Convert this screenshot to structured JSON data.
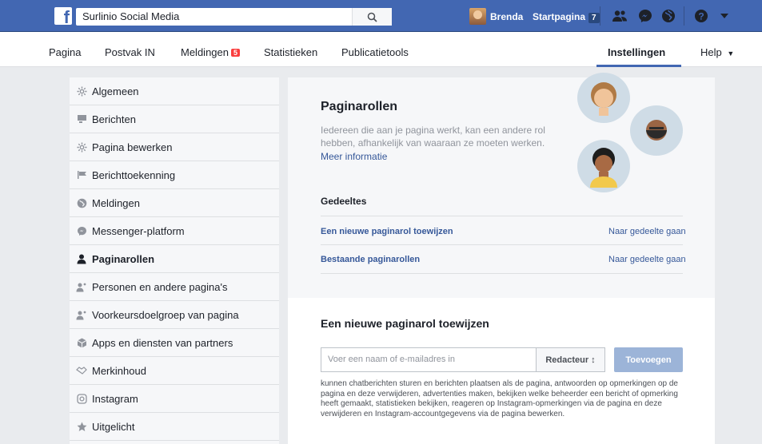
{
  "topbar": {
    "search_value": "Surlinio Social Media",
    "user_name": "Brenda",
    "home_label": "Startpagina",
    "home_count": "7"
  },
  "pagenav": {
    "items": {
      "pagina": "Pagina",
      "postvak": "Postvak IN",
      "meldingen": "Meldingen",
      "meldingen_badge": "5",
      "statistieken": "Statistieken",
      "publicatietools": "Publicatietools",
      "instellingen": "Instellingen",
      "help": "Help"
    }
  },
  "sidebar": {
    "items": [
      {
        "label": "Algemeen",
        "icon": "gear-icon"
      },
      {
        "label": "Berichten",
        "icon": "messages-icon"
      },
      {
        "label": "Pagina bewerken",
        "icon": "gear-icon"
      },
      {
        "label": "Berichttoekenning",
        "icon": "flag-icon"
      },
      {
        "label": "Meldingen",
        "icon": "globe-icon"
      },
      {
        "label": "Messenger-platform",
        "icon": "messenger-icon"
      },
      {
        "label": "Paginarollen",
        "icon": "person-icon",
        "active": true
      },
      {
        "label": "Personen en andere pagina's",
        "icon": "people-icon"
      },
      {
        "label": "Voorkeursdoelgroep van pagina",
        "icon": "people-icon"
      },
      {
        "label": "Apps en diensten van partners",
        "icon": "cube-icon"
      },
      {
        "label": "Merkinhoud",
        "icon": "handshake-icon"
      },
      {
        "label": "Instagram",
        "icon": "instagram-icon"
      },
      {
        "label": "Uitgelicht",
        "icon": "star-icon"
      }
    ]
  },
  "roles": {
    "title": "Paginarollen",
    "intro": "Iedereen die aan je pagina werkt, kan een andere rol hebben, afhankelijk van waaraan ze moeten werken.",
    "more_link": "Meer informatie",
    "shared_label": "Gedeeltes",
    "rows": [
      {
        "label": "Een nieuwe paginarol toewijzen",
        "action": "Naar gedeelte gaan"
      },
      {
        "label": "Bestaande paginarollen",
        "action": "Naar gedeelte gaan"
      }
    ]
  },
  "assign": {
    "title": "Een nieuwe paginarol toewijzen",
    "input_placeholder": "Voer een naam of e-mailadres in",
    "role_value": "Redacteur ↕",
    "add_button": "Toevoegen",
    "description": "kunnen chatberichten sturen en berichten plaatsen als de pagina, antwoorden op opmerkingen op de pagina en deze verwijderen, advertenties maken, bekijken welke beheerder een bericht of opmerking heeft gemaakt, statistieken bekijken, reageren op Instagram-opmerkingen via de pagina en deze verwijderen en Instagram-accountgegevens via de pagina bewerken."
  },
  "colors": {
    "brand": "#4267b2",
    "link": "#365899",
    "badge": "#fa3e3e"
  }
}
